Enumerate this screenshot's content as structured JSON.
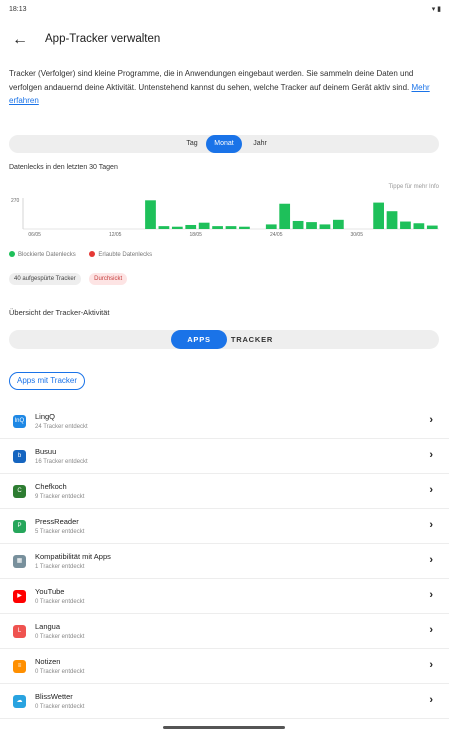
{
  "status": {
    "time": "18:13",
    "time_icon": "cloud-icon",
    "right_icons": "wifi-icon battery-icon"
  },
  "header": {
    "title": "App-Tracker verwalten"
  },
  "intro": {
    "text": "Tracker (Verfolger) sind kleine Programme, die in Anwendungen eingebaut werden. Sie sammeln deine Daten und verfolgen andauernd deine Aktivität. Untenstehend kannst du sehen, welche Tracker auf deinem Gerät aktiv sind.",
    "link": "Mehr erfahren"
  },
  "period_tabs": [
    {
      "label": "Tag",
      "active": false
    },
    {
      "label": "Monat",
      "active": true
    },
    {
      "label": "Jahr",
      "active": false
    }
  ],
  "chart_title": "Datenlecks in den letzten 30 Tagen",
  "chart_hint": "Tippe für mehr Info",
  "chart_data": {
    "type": "bar",
    "title": "Datenlecks in den letzten 30 Tagen",
    "ylim": [
      0,
      270
    ],
    "y_tick_labels": [
      "270"
    ],
    "x_tick_labels": [
      "06/05",
      "12/05",
      "18/05",
      "24/05",
      "30/05"
    ],
    "x_tick_days": [
      1,
      7,
      13,
      19,
      25
    ],
    "series": [
      {
        "name": "Blockierte Datenlecks",
        "color": "#1ec05a",
        "values": [
          0,
          0,
          0,
          0,
          0,
          0,
          0,
          0,
          0,
          250,
          25,
          20,
          35,
          55,
          25,
          25,
          20,
          0,
          40,
          220,
          70,
          60,
          40,
          80,
          0,
          0,
          230,
          155,
          65,
          50,
          30
        ]
      }
    ]
  },
  "legend": [
    {
      "label": "Blockierte Datenlecks",
      "color": "#1ec05a"
    },
    {
      "label": "Erlaubte Datenlecks",
      "color": "#e53935"
    }
  ],
  "chips": {
    "trackers": "40 aufgespürte Tracker",
    "leaked": "Durchsickt"
  },
  "overview_title": "Übersicht der Tracker-Aktivität",
  "view_tabs": [
    {
      "label": "APPS",
      "active": true
    },
    {
      "label": "TRACKER",
      "active": false
    }
  ],
  "filter_button": "Apps mit Tracker",
  "apps": [
    {
      "name": "LingQ",
      "sub": "24 Tracker entdeckt",
      "icon": "lingq-icon",
      "color": "#1e88e5",
      "glyph": "lnQ"
    },
    {
      "name": "Busuu",
      "sub": "16 Tracker entdeckt",
      "icon": "busuu-icon",
      "color": "#1565c0",
      "glyph": "b"
    },
    {
      "name": "Chefkoch",
      "sub": "9 Tracker entdeckt",
      "icon": "chefkoch-icon",
      "color": "#2e7d32",
      "glyph": "C"
    },
    {
      "name": "PressReader",
      "sub": "5 Tracker entdeckt",
      "icon": "pressreader-icon",
      "color": "#26a65b",
      "glyph": "P"
    },
    {
      "name": "Kompatibilität mit Apps",
      "sub": "1 Tracker entdeckt",
      "icon": "compatibility-icon",
      "color": "#78909c",
      "glyph": "▦"
    },
    {
      "name": "YouTube",
      "sub": "0 Tracker entdeckt",
      "icon": "youtube-icon",
      "color": "#ff0000",
      "glyph": "▶"
    },
    {
      "name": "Langua",
      "sub": "0 Tracker entdeckt",
      "icon": "langua-icon",
      "color": "#ef5350",
      "glyph": "L"
    },
    {
      "name": "Notizen",
      "sub": "0 Tracker entdeckt",
      "icon": "notes-icon",
      "color": "#ff8f00",
      "glyph": "≡"
    },
    {
      "name": "BlissWetter",
      "sub": "0 Tracker entdeckt",
      "icon": "weather-icon",
      "color": "#29a3e0",
      "glyph": "☁"
    }
  ]
}
